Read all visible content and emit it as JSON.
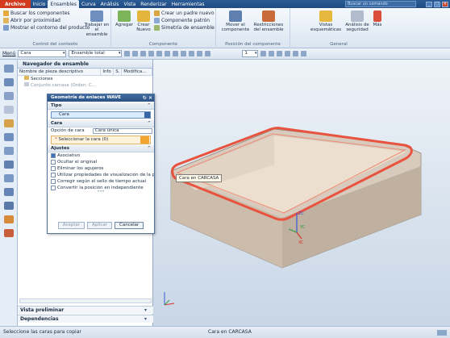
{
  "menu": {
    "archivo": "Archivo",
    "items": [
      "Inicio",
      "Ensambles",
      "Curva",
      "Análisis",
      "Vista",
      "Renderizar",
      "Herramientas"
    ],
    "search_placeholder": "Buscar un comando"
  },
  "ribbon": {
    "contexto": {
      "items": [
        "Buscar los componentes",
        "Abrir por proximidad",
        "Mostrar el contorno del producto"
      ],
      "trabajar": "Trabajar en el ensamble",
      "title": "Control del contexto"
    },
    "componente": {
      "agregar": "Agregar",
      "crear": "Crear Nuevo",
      "items": [
        "Crear un padre nuevo",
        "Componente patrón",
        "Simetría de ensamble"
      ],
      "title": "Componente"
    },
    "posicion": {
      "mover": "Mover el componente",
      "restricciones": "Restricciones del ensamble",
      "title": "Posición del componente"
    },
    "general": {
      "vistas": "Vistas esquemáticas",
      "analisis": "Análisis de seguridad",
      "mas": "Más",
      "title": "General"
    }
  },
  "toolbar2": {
    "menu": "Menú",
    "filter": "Cara",
    "scope": "Ensamble total",
    "number": "1"
  },
  "navigator": {
    "title": "Navegador de ensamble",
    "columns": [
      "Nombre de pieza descriptivo",
      "Info",
      "S.",
      "Modifica..."
    ],
    "rows": [
      "Secciones",
      "Conjunto carcasa (Orden: C..."
    ],
    "preview": "Vista preliminar",
    "dependencies": "Dependencias"
  },
  "dialog": {
    "title": "Geometría de enlaces WAVE",
    "tipo_section": "Tipo",
    "tipo_value": "Cara",
    "cara_section": "Cara",
    "opcion_label": "Opción de cara",
    "opcion_value": "Cara única",
    "select_face": "Seleccionar la cara (0)",
    "ajustes_section": "Ajustes",
    "checks": [
      {
        "label": "Asociativo",
        "on": true
      },
      {
        "label": "Ocultar el original",
        "on": false
      },
      {
        "label": "Eliminar los agujeros",
        "on": false
      },
      {
        "label": "Utilizar propiedades de visualización de la pie",
        "on": false
      },
      {
        "label": "Corregir según el sello de tiempo actual",
        "on": false
      },
      {
        "label": "Convertir la posición en independiente",
        "on": false
      }
    ],
    "buttons": {
      "aceptar": "Aceptar",
      "aplicar": "Aplicar",
      "cancelar": "Cancelar"
    }
  },
  "viewport": {
    "tooltip": "Cara en CARCASA",
    "axes": [
      "ZC",
      "YC",
      "XC"
    ],
    "colors": {
      "body": "#d8cbbd",
      "highlight": "#e8533f"
    }
  },
  "status": {
    "left": "Seleccione las caras para copiar",
    "mid": "Cara en CARCASA"
  }
}
